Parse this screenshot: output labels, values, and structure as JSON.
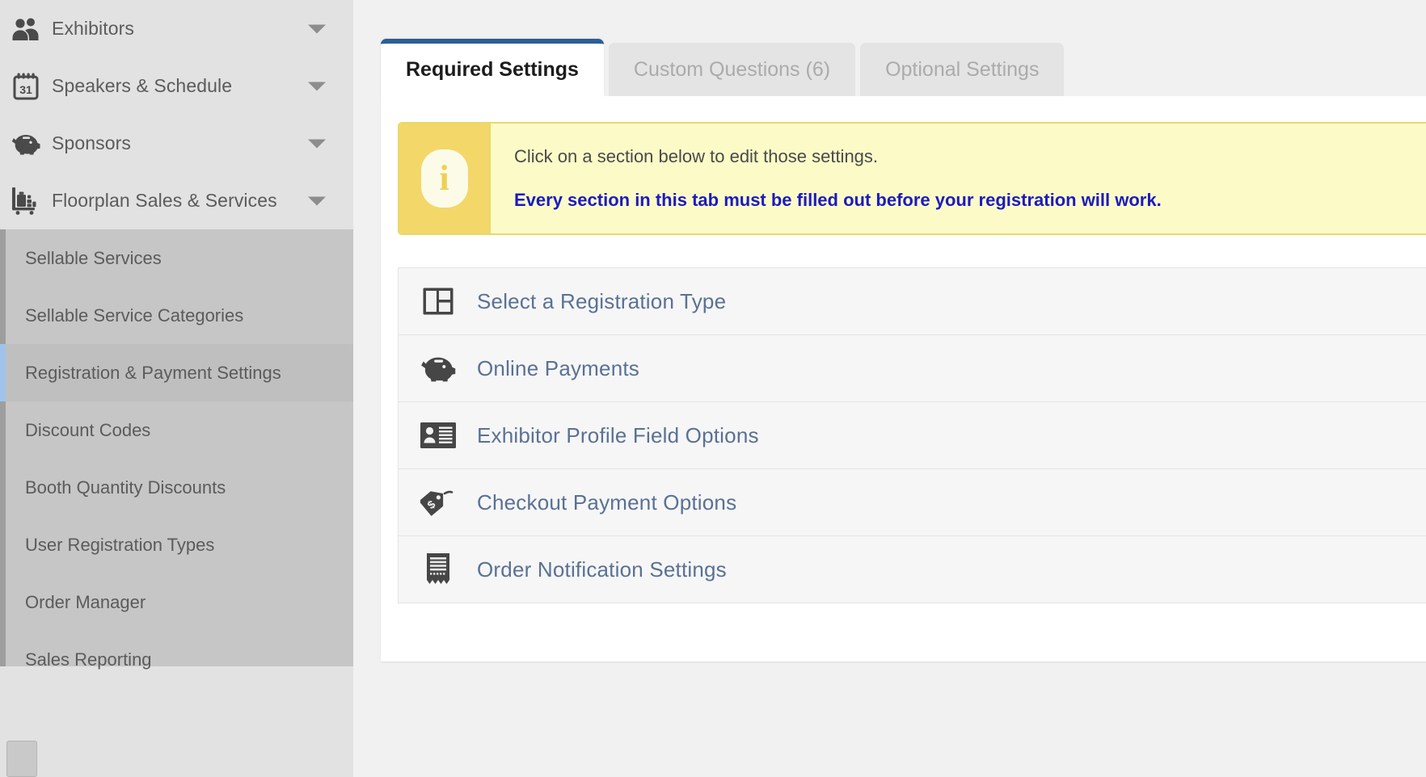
{
  "sidebar": {
    "nav_items": [
      {
        "label": "Exhibitors",
        "icon": "people-icon",
        "caret": "chevron-down-icon"
      },
      {
        "label": "Speakers & Schedule",
        "icon": "calendar-31-icon",
        "caret": "chevron-down-icon"
      },
      {
        "label": "Sponsors",
        "icon": "piggy-bank-icon",
        "caret": "chevron-down-icon"
      },
      {
        "label": "Floorplan Sales & Services",
        "icon": "luggage-cart-icon",
        "caret": "chevron-down-icon"
      }
    ],
    "submenu_items": [
      {
        "label": "Sellable Services",
        "active": false
      },
      {
        "label": "Sellable Service Categories",
        "active": false
      },
      {
        "label": "Registration & Payment Settings",
        "active": true
      },
      {
        "label": "Discount Codes",
        "active": false
      },
      {
        "label": "Booth Quantity Discounts",
        "active": false
      },
      {
        "label": "User Registration Types",
        "active": false
      },
      {
        "label": "Order Manager",
        "active": false
      },
      {
        "label": "Sales Reporting",
        "active": false
      }
    ]
  },
  "main": {
    "tabs": [
      {
        "label": "Required Settings",
        "active": true
      },
      {
        "label": "Custom Questions (6)",
        "active": false
      },
      {
        "label": "Optional Settings",
        "active": false
      }
    ],
    "alert": {
      "icon": "info-icon",
      "icon_glyph": "i",
      "line1": "Click on a section below to edit those settings.",
      "line2": "Every section in this tab must be filled out before your registration will work."
    },
    "sections": [
      {
        "label": "Select a Registration Type",
        "icon": "layout-panels-icon"
      },
      {
        "label": "Online Payments",
        "icon": "piggy-bank-icon"
      },
      {
        "label": "Exhibitor Profile Field Options",
        "icon": "id-card-icon"
      },
      {
        "label": "Checkout Payment Options",
        "icon": "price-tag-dollar-icon"
      },
      {
        "label": "Order Notification Settings",
        "icon": "receipt-icon"
      }
    ]
  },
  "colors": {
    "active_tab_accent": "#2c5f96",
    "section_link": "#5a7194",
    "alert_bg": "#fcfbc8",
    "alert_icon_bg": "#f3d769",
    "alert_border": "#e7d96a",
    "alert_emphasis_text": "#1b1bbf",
    "sidebar_bg": "#e2e2e2",
    "submenu_bg": "#c6c6c6",
    "active_submenu_marker": "#9fc4ec"
  }
}
